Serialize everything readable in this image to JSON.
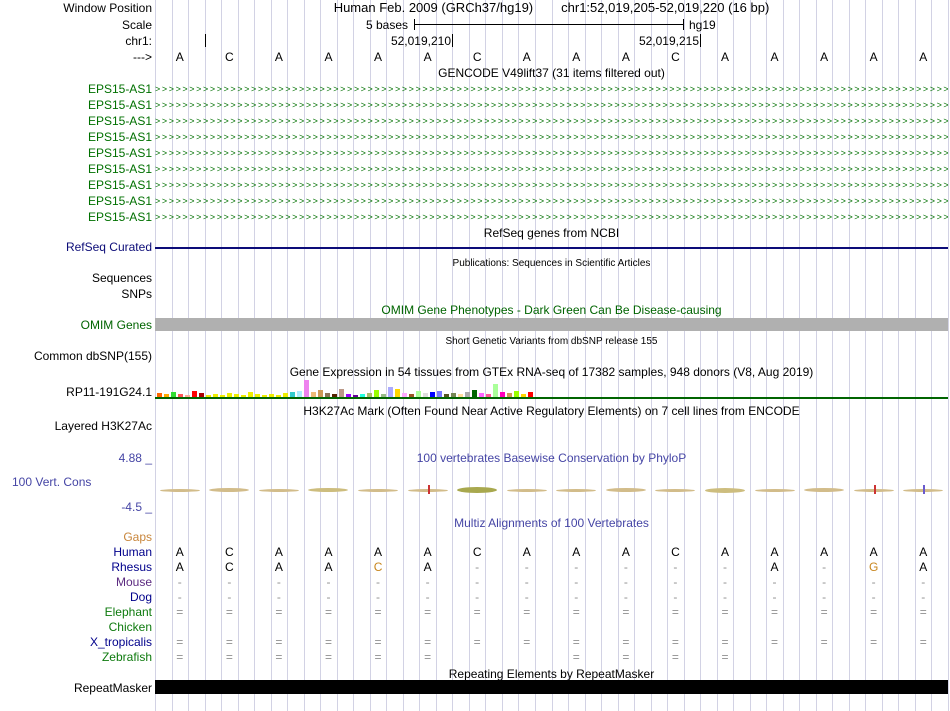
{
  "grid": {
    "line_color": "#d2d2e4"
  },
  "window": {
    "label_window_position": "Window Position",
    "assembly": "Human Feb. 2009 (GRCh37/hg19)",
    "position": "chr1:52,019,205-52,019,220 (16 bp)"
  },
  "scale": {
    "label": "Scale",
    "bases": "5 bases",
    "genome": "hg19"
  },
  "ruler": {
    "chrom": "chr1:",
    "left_coord": "52,019,210",
    "right_coord": "52,019,215",
    "strand": "--->"
  },
  "sequence": [
    "A",
    "C",
    "A",
    "A",
    "A",
    "A",
    "C",
    "A",
    "A",
    "A",
    "C",
    "A",
    "A",
    "A",
    "A",
    "A"
  ],
  "gencode": {
    "title": "GENCODE V49lift37 (31 items filtered out)",
    "gene": "EPS15-AS1",
    "row_count": 9,
    "arrow": ">",
    "color": "#007000"
  },
  "refseq": {
    "title": "RefSeq genes from NCBI",
    "label": "RefSeq Curated",
    "color": "#0c0c78"
  },
  "publications": {
    "title": "Publications: Sequences in Scientific Articles",
    "label_sequences": "Sequences",
    "label_snps": "SNPs"
  },
  "omim": {
    "title": "OMIM Gene Phenotypes - Dark Green Can Be Disease-causing",
    "label": "OMIM Genes",
    "title_color": "#006400",
    "bar_color": "#b0b0b0"
  },
  "dbsnp": {
    "title": "Short Genetic Variants from dbSNP release 155",
    "label": "Common dbSNP(155)"
  },
  "gtex": {
    "title": "Gene Expression in 54 tissues from GTEx RNA-seq of 17382 samples, 948 donors (V8, Aug 2019)",
    "label": "RP11-191G24.1",
    "baseline_color": "#006400",
    "bars": [
      {
        "h": 4,
        "c": "#ff6600"
      },
      {
        "h": 3,
        "c": "#ffaa00"
      },
      {
        "h": 5,
        "c": "#33dd33"
      },
      {
        "h": 3,
        "c": "#ff5555"
      },
      {
        "h": 2,
        "c": "#ffaa99"
      },
      {
        "h": 6,
        "c": "#ff0000"
      },
      {
        "h": 4,
        "c": "#aa0000"
      },
      {
        "h": 2,
        "c": "#eeee00"
      },
      {
        "h": 3,
        "c": "#eeee00"
      },
      {
        "h": 2,
        "c": "#eeee00"
      },
      {
        "h": 4,
        "c": "#eeee00"
      },
      {
        "h": 3,
        "c": "#eeee00"
      },
      {
        "h": 2,
        "c": "#eeee00"
      },
      {
        "h": 5,
        "c": "#eeee00"
      },
      {
        "h": 3,
        "c": "#eeee00"
      },
      {
        "h": 2,
        "c": "#eeee00"
      },
      {
        "h": 3,
        "c": "#eeee00"
      },
      {
        "h": 2,
        "c": "#eeee00"
      },
      {
        "h": 4,
        "c": "#eeee00"
      },
      {
        "h": 5,
        "c": "#33cccc"
      },
      {
        "h": 6,
        "c": "#aaeeff"
      },
      {
        "h": 17,
        "c": "#ee82ee"
      },
      {
        "h": 5,
        "c": "#eebb77"
      },
      {
        "h": 7,
        "c": "#cc9955"
      },
      {
        "h": 4,
        "c": "#8b7355"
      },
      {
        "h": 3,
        "c": "#552200"
      },
      {
        "h": 8,
        "c": "#bb9988"
      },
      {
        "h": 3,
        "c": "#9900ff"
      },
      {
        "h": 2,
        "c": "#660099"
      },
      {
        "h": 3,
        "c": "#22ffdd"
      },
      {
        "h": 4,
        "c": "#aabb66"
      },
      {
        "h": 7,
        "c": "#99ff00"
      },
      {
        "h": 3,
        "c": "#99bb88"
      },
      {
        "h": 10,
        "c": "#aaaaff"
      },
      {
        "h": 8,
        "c": "#ffd700"
      },
      {
        "h": 4,
        "c": "#ffaaff"
      },
      {
        "h": 3,
        "c": "#995522"
      },
      {
        "h": 6,
        "c": "#aaff99"
      },
      {
        "h": 4,
        "c": "#dddddd"
      },
      {
        "h": 5,
        "c": "#0000ff"
      },
      {
        "h": 6,
        "c": "#7777ff"
      },
      {
        "h": 3,
        "c": "#555522"
      },
      {
        "h": 4,
        "c": "#778855"
      },
      {
        "h": 3,
        "c": "#ffdd99"
      },
      {
        "h": 5,
        "c": "#aaaaaa"
      },
      {
        "h": 7,
        "c": "#006600"
      },
      {
        "h": 4,
        "c": "#ff66ff"
      },
      {
        "h": 3,
        "c": "#ff5599"
      },
      {
        "h": 13,
        "c": "#aaff99"
      },
      {
        "h": 5,
        "c": "#ff00bb"
      },
      {
        "h": 4,
        "c": "#cc9955"
      },
      {
        "h": 6,
        "c": "#99ff00"
      },
      {
        "h": 3,
        "c": "#ffd700"
      },
      {
        "h": 5,
        "c": "#ff0000"
      }
    ]
  },
  "encode": {
    "title": "H3K27Ac Mark (Often Found Near Active Regulatory Elements) on 7 cell lines from ENCODE",
    "label": "Layered H3K27Ac"
  },
  "conservation": {
    "title": "100 vertebrates Basewise Conservation by PhyloP",
    "label": "100 Vert. Cons",
    "max_label": "4.88 _",
    "min_label": "-4.5 _",
    "title_color": "#4545a5",
    "label_color": "#4545a5",
    "wiggle": [
      {
        "h": 3,
        "c": "#d2bc8a"
      },
      {
        "h": 4,
        "c": "#d2bc8a"
      },
      {
        "h": 3,
        "c": "#d2bc8a"
      },
      {
        "h": 4,
        "c": "#cdbd7e"
      },
      {
        "h": 3,
        "c": "#d2bc8a"
      },
      {
        "h": 3,
        "c": "#d2bc8a"
      },
      {
        "h": 6,
        "c": "#a8a84e"
      },
      {
        "h": 3,
        "c": "#d2bc8a"
      },
      {
        "h": 3,
        "c": "#d2bc8a"
      },
      {
        "h": 4,
        "c": "#d2bc8a"
      },
      {
        "h": 3,
        "c": "#d2bc8a"
      },
      {
        "h": 5,
        "c": "#cdbd7e"
      },
      {
        "h": 3,
        "c": "#d2bc8a"
      },
      {
        "h": 4,
        "c": "#d2bc8a"
      },
      {
        "h": 3,
        "c": "#d2bc8a"
      },
      {
        "h": 3,
        "c": "#d2bc8a"
      }
    ],
    "ticks": [
      {
        "col": 5,
        "c": "#cc3333"
      },
      {
        "col": 14,
        "c": "#cc3333"
      },
      {
        "col": 15,
        "c": "#6a5acd"
      }
    ]
  },
  "multiz": {
    "title": "Multiz Alignments of 100 Vertebrates",
    "title_color": "#4545a5",
    "rows": [
      {
        "species": "Gaps",
        "color": "#c8863c",
        "cells": [
          "",
          "",
          "",
          "",
          "",
          "",
          "",
          "",
          "",
          "",
          "",
          "",
          "",
          "",
          "",
          ""
        ]
      },
      {
        "species": "Human",
        "color": "#00008b",
        "cells": [
          "A",
          "C",
          "A",
          "A",
          "A",
          "A",
          "C",
          "A",
          "A",
          "A",
          "C",
          "A",
          "A",
          "A",
          "A",
          "A"
        ]
      },
      {
        "species": "Rhesus",
        "color": "#00008b",
        "cells": [
          "A",
          "C",
          "A",
          "A",
          "C",
          "A",
          "-",
          "-",
          "-",
          "-",
          "-",
          "-",
          "A",
          "-",
          "G",
          "A"
        ],
        "cell_colors": {
          "4": "#c8861e",
          "14": "#c8861e"
        }
      },
      {
        "species": "Mouse",
        "color": "#5c2a80",
        "cells": [
          "-",
          "-",
          "-",
          "-",
          "-",
          "-",
          "-",
          "-",
          "-",
          "-",
          "-",
          "-",
          "-",
          "-",
          "-",
          "-"
        ]
      },
      {
        "species": "Dog",
        "color": "#00008b",
        "cells": [
          "-",
          "-",
          "-",
          "-",
          "-",
          "-",
          "-",
          "-",
          "-",
          "-",
          "-",
          "-",
          "-",
          "-",
          "-",
          "-"
        ]
      },
      {
        "species": "Elephant",
        "color": "#0e7a0e",
        "cells": [
          "=",
          "=",
          "=",
          "=",
          "=",
          "=",
          "=",
          "=",
          "=",
          "=",
          "=",
          "=",
          "=",
          "=",
          "=",
          "="
        ]
      },
      {
        "species": "Chicken",
        "color": "#0e7a0e",
        "cells": [
          "",
          "",
          "",
          "",
          "",
          "",
          "",
          "",
          "",
          "",
          "",
          "",
          "",
          "",
          "",
          ""
        ]
      },
      {
        "species": "X_tropicalis",
        "color": "#00008b",
        "cells": [
          "=",
          "=",
          "=",
          "=",
          "=",
          "=",
          "=",
          "=",
          "=",
          "=",
          "=",
          "=",
          "=",
          "=",
          "=",
          "="
        ]
      },
      {
        "species": "Zebrafish",
        "color": "#0e7a0e",
        "cells": [
          "=",
          "=",
          "=",
          "=",
          "=",
          "=",
          "",
          "",
          "=",
          "=",
          "=",
          "=",
          "",
          "",
          "",
          ""
        ]
      }
    ]
  },
  "repeatmasker": {
    "title": "Repeating Elements by RepeatMasker",
    "label": "RepeatMasker",
    "bar_color": "#000000"
  }
}
